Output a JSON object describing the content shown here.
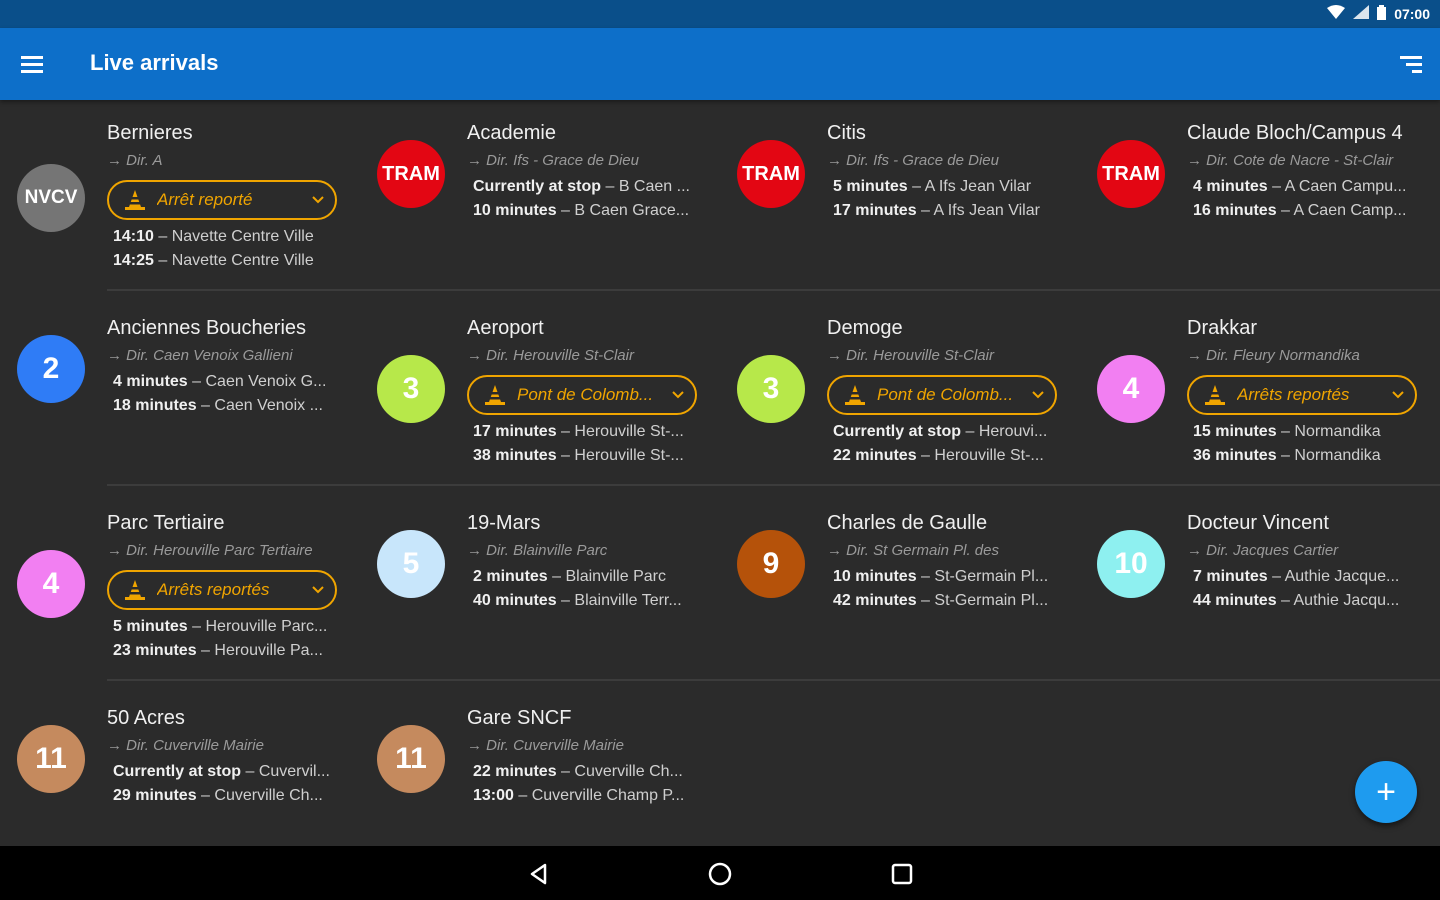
{
  "status_bar": {
    "time": "07:00",
    "icons": [
      "wifi-icon",
      "signal-icon",
      "battery-icon"
    ]
  },
  "app_bar": {
    "title": "Live arrivals",
    "menu_icon": "menu-icon",
    "sort_icon": "sort-icon"
  },
  "colors": {
    "app_bar": "#0d6fc9",
    "status_bar": "#0a4f8a",
    "background": "#2b2b2b",
    "alert": "#f0a500",
    "fab": "#1e9bef"
  },
  "stops": [
    {
      "name": "Bernieres",
      "direction": "→ Dir. A",
      "line": "NVCV",
      "line_color": "#757575",
      "alert": "Arrêt reporté",
      "arrivals": [
        {
          "time": "14:10",
          "dest": "Navette Centre Ville"
        },
        {
          "time": "14:25",
          "dest": "Navette Centre Ville"
        }
      ]
    },
    {
      "name": "Academie",
      "direction": "→ Dir. Ifs - Grace de Dieu",
      "line": "TRAM",
      "line_color": "#e30613",
      "alert": null,
      "arrivals": [
        {
          "time": "Currently at stop",
          "dest": "B Caen ..."
        },
        {
          "time": "10 minutes",
          "dest": "B Caen Grace..."
        }
      ]
    },
    {
      "name": "Citis",
      "direction": "→ Dir. Ifs - Grace de Dieu",
      "line": "TRAM",
      "line_color": "#e30613",
      "alert": null,
      "arrivals": [
        {
          "time": "5 minutes",
          "dest": "A Ifs Jean Vilar"
        },
        {
          "time": "17 minutes",
          "dest": "A Ifs Jean Vilar"
        }
      ]
    },
    {
      "name": "Claude Bloch/Campus 4",
      "direction": "→ Dir. Cote de Nacre - St-Clair",
      "line": "TRAM",
      "line_color": "#e30613",
      "alert": null,
      "arrivals": [
        {
          "time": "4 minutes",
          "dest": "A Caen Campu..."
        },
        {
          "time": "16 minutes",
          "dest": "A Caen Camp..."
        }
      ]
    },
    {
      "name": "Anciennes Boucheries",
      "direction": "→ Dir. Caen Venoix Gallieni",
      "line": "2",
      "line_color": "#2f7cf6",
      "alert": null,
      "arrivals": [
        {
          "time": "4 minutes",
          "dest": "Caen Venoix G..."
        },
        {
          "time": "18 minutes",
          "dest": "Caen Venoix ..."
        }
      ]
    },
    {
      "name": "Aeroport",
      "direction": "→ Dir. Herouville St-Clair",
      "line": "3",
      "line_color": "#b7e84a",
      "alert": "Pont de Colomb...",
      "arrivals": [
        {
          "time": "17 minutes",
          "dest": "Herouville St-..."
        },
        {
          "time": "38 minutes",
          "dest": "Herouville St-..."
        }
      ]
    },
    {
      "name": "Demoge",
      "direction": "→ Dir. Herouville St-Clair",
      "line": "3",
      "line_color": "#b7e84a",
      "alert": "Pont de Colomb...",
      "arrivals": [
        {
          "time": "Currently at stop",
          "dest": "Herouvi..."
        },
        {
          "time": "22 minutes",
          "dest": "Herouville St-..."
        }
      ]
    },
    {
      "name": "Drakkar",
      "direction": "→ Dir. Fleury Normandika",
      "line": "4",
      "line_color": "#f27ff2",
      "alert": "Arrêts reportés",
      "arrivals": [
        {
          "time": "15 minutes",
          "dest": "Normandika"
        },
        {
          "time": "36 minutes",
          "dest": "Normandika"
        }
      ]
    },
    {
      "name": "Parc Tertiaire",
      "direction": "→ Dir. Herouville Parc Tertiaire",
      "line": "4",
      "line_color": "#f27ff2",
      "alert": "Arrêts reportés",
      "arrivals": [
        {
          "time": "5 minutes",
          "dest": "Herouville Parc..."
        },
        {
          "time": "23 minutes",
          "dest": "Herouville Pa..."
        }
      ]
    },
    {
      "name": "19-Mars",
      "direction": "→ Dir. Blainville Parc",
      "line": "5",
      "line_color": "#c8e6fb",
      "alert": null,
      "arrivals": [
        {
          "time": "2 minutes",
          "dest": "Blainville Parc"
        },
        {
          "time": "40 minutes",
          "dest": "Blainville Terr..."
        }
      ]
    },
    {
      "name": "Charles de Gaulle",
      "direction": "→ Dir. St Germain Pl. des",
      "line": "9",
      "line_color": "#b5520a",
      "alert": null,
      "arrivals": [
        {
          "time": "10 minutes",
          "dest": "St-Germain Pl..."
        },
        {
          "time": "42 minutes",
          "dest": "St-Germain Pl..."
        }
      ]
    },
    {
      "name": "Docteur Vincent",
      "direction": "→ Dir. Jacques Cartier",
      "line": "10",
      "line_color": "#8ef0f0",
      "alert": null,
      "arrivals": [
        {
          "time": "7 minutes",
          "dest": "Authie Jacque..."
        },
        {
          "time": "44 minutes",
          "dest": "Authie Jacqu..."
        }
      ]
    },
    {
      "name": "50 Acres",
      "direction": "→ Dir. Cuverville Mairie",
      "line": "11",
      "line_color": "#c58a5e",
      "alert": null,
      "arrivals": [
        {
          "time": "Currently at stop",
          "dest": "Cuvervil..."
        },
        {
          "time": "29 minutes",
          "dest": "Cuverville Ch..."
        }
      ]
    },
    {
      "name": "Gare SNCF",
      "direction": "→ Dir. Cuverville Mairie",
      "line": "11",
      "line_color": "#c58a5e",
      "alert": null,
      "arrivals": [
        {
          "time": "22 minutes",
          "dest": "Cuverville Ch..."
        },
        {
          "time": "13:00",
          "dest": "Cuverville Champ P..."
        }
      ]
    }
  ],
  "fab": {
    "label": "+",
    "icon": "add-icon"
  },
  "nav_bar": {
    "buttons": [
      "back-icon",
      "home-icon",
      "recents-icon"
    ]
  }
}
